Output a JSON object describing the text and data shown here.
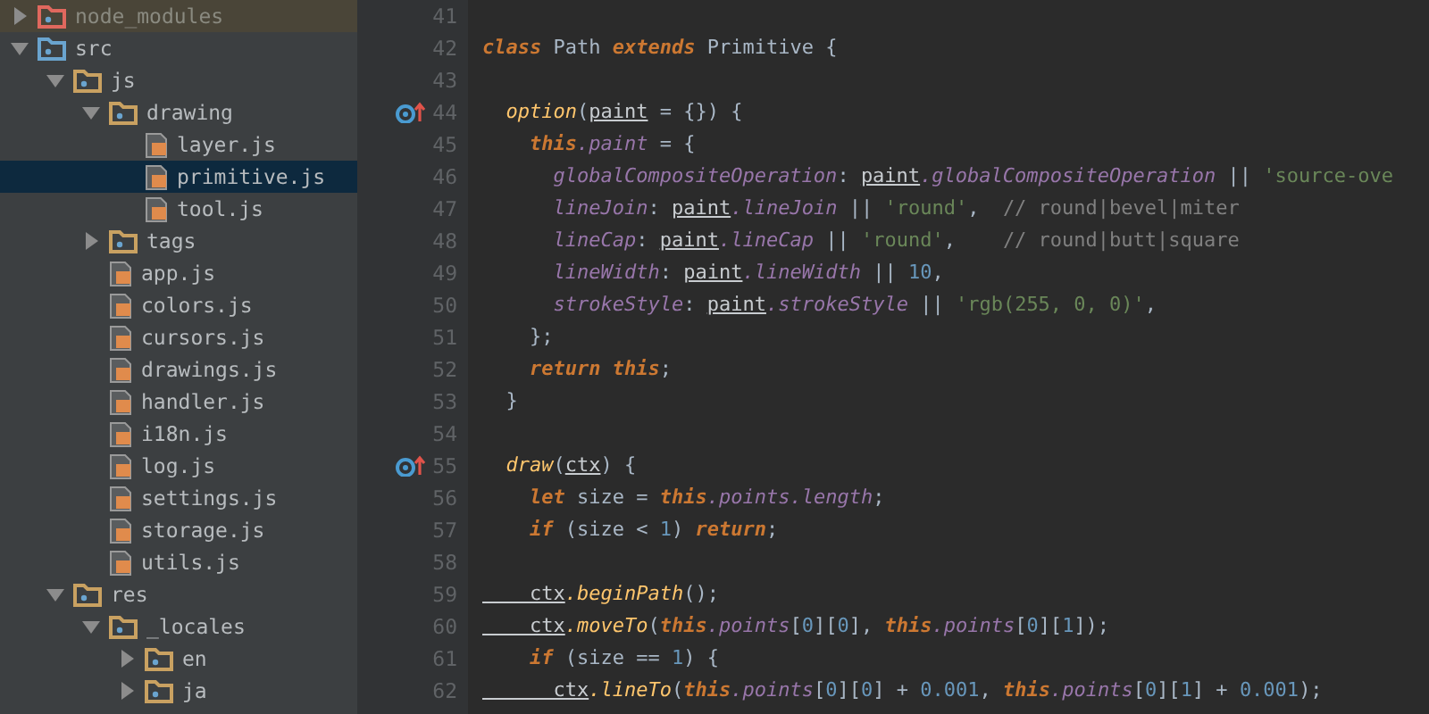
{
  "tree": [
    {
      "kind": "folder",
      "label": "node_modules",
      "color": "#e0685e",
      "expanded": false,
      "excluded": true,
      "selected": false
    },
    {
      "kind": "folder",
      "label": "src",
      "color": "#6aa4cf",
      "expanded": true,
      "excluded": false,
      "selected": false,
      "children": [
        {
          "kind": "folder",
          "label": "js",
          "color": "#c9a161",
          "expanded": true,
          "excluded": false,
          "selected": false,
          "children": [
            {
              "kind": "folder",
              "label": "drawing",
              "color": "#c9a161",
              "expanded": true,
              "excluded": false,
              "selected": false,
              "children": [
                {
                  "kind": "file",
                  "label": "layer.js",
                  "selected": false
                },
                {
                  "kind": "file",
                  "label": "primitive.js",
                  "selected": true
                },
                {
                  "kind": "file",
                  "label": "tool.js",
                  "selected": false
                }
              ]
            },
            {
              "kind": "folder",
              "label": "tags",
              "color": "#c9a161",
              "expanded": false,
              "excluded": false,
              "selected": false
            },
            {
              "kind": "file",
              "label": "app.js",
              "selected": false
            },
            {
              "kind": "file",
              "label": "colors.js",
              "selected": false
            },
            {
              "kind": "file",
              "label": "cursors.js",
              "selected": false
            },
            {
              "kind": "file",
              "label": "drawings.js",
              "selected": false
            },
            {
              "kind": "file",
              "label": "handler.js",
              "selected": false
            },
            {
              "kind": "file",
              "label": "i18n.js",
              "selected": false
            },
            {
              "kind": "file",
              "label": "log.js",
              "selected": false
            },
            {
              "kind": "file",
              "label": "settings.js",
              "selected": false
            },
            {
              "kind": "file",
              "label": "storage.js",
              "selected": false
            },
            {
              "kind": "file",
              "label": "utils.js",
              "selected": false
            }
          ]
        },
        {
          "kind": "folder",
          "label": "res",
          "color": "#c9a161",
          "expanded": true,
          "excluded": false,
          "selected": false,
          "children": [
            {
              "kind": "folder",
              "label": "_locales",
              "color": "#c9a161",
              "expanded": true,
              "excluded": false,
              "selected": false,
              "children": [
                {
                  "kind": "folder",
                  "label": "en",
                  "color": "#c9a161",
                  "expanded": false,
                  "excluded": false,
                  "selected": false
                },
                {
                  "kind": "folder",
                  "label": "ja",
                  "color": "#c9a161",
                  "expanded": false,
                  "excluded": false,
                  "selected": false
                }
              ]
            }
          ]
        }
      ]
    }
  ],
  "editor": {
    "lines": [
      {
        "number": "41",
        "marker": false
      },
      {
        "number": "42",
        "marker": false,
        "tokens": [
          {
            "kind": "kw",
            "text": "class "
          },
          {
            "kind": "name",
            "text": "Path "
          },
          {
            "kind": "kw",
            "text": "extends "
          },
          {
            "kind": "name",
            "text": "Primitive "
          },
          {
            "kind": "punct",
            "text": "{"
          }
        ]
      },
      {
        "number": "43",
        "marker": false
      },
      {
        "number": "44",
        "marker": true,
        "tokens": [
          {
            "kind": "fn",
            "text": "  option"
          },
          {
            "kind": "punct",
            "text": "("
          },
          {
            "kind": "param",
            "text": "paint"
          },
          {
            "kind": "punct",
            "text": " = {}) {"
          }
        ]
      },
      {
        "number": "45",
        "marker": false,
        "tokens": [
          {
            "kind": "kw",
            "text": "    this"
          },
          {
            "kind": "prop",
            "text": ".paint"
          },
          {
            "kind": "punct",
            "text": " = {"
          }
        ]
      },
      {
        "number": "46",
        "marker": false,
        "tokens": [
          {
            "kind": "prop",
            "text": "      globalCompositeOperation"
          },
          {
            "kind": "punct",
            "text": ": "
          },
          {
            "kind": "param",
            "text": "paint"
          },
          {
            "kind": "prop",
            "text": ".globalCompositeOperation"
          },
          {
            "kind": "punct",
            "text": " || "
          },
          {
            "kind": "str",
            "text": "'source-ove"
          }
        ]
      },
      {
        "number": "47",
        "marker": false,
        "tokens": [
          {
            "kind": "prop",
            "text": "      lineJoin"
          },
          {
            "kind": "punct",
            "text": ": "
          },
          {
            "kind": "param",
            "text": "paint"
          },
          {
            "kind": "prop",
            "text": ".lineJoin"
          },
          {
            "kind": "punct",
            "text": " || "
          },
          {
            "kind": "str",
            "text": "'round'"
          },
          {
            "kind": "punct",
            "text": ",  "
          },
          {
            "kind": "comment",
            "text": "// round|bevel|miter"
          }
        ]
      },
      {
        "number": "48",
        "marker": false,
        "tokens": [
          {
            "kind": "prop",
            "text": "      lineCap"
          },
          {
            "kind": "punct",
            "text": ": "
          },
          {
            "kind": "param",
            "text": "paint"
          },
          {
            "kind": "prop",
            "text": ".lineCap"
          },
          {
            "kind": "punct",
            "text": " || "
          },
          {
            "kind": "str",
            "text": "'round'"
          },
          {
            "kind": "punct",
            "text": ",    "
          },
          {
            "kind": "comment",
            "text": "// round|butt|square"
          }
        ]
      },
      {
        "number": "49",
        "marker": false,
        "tokens": [
          {
            "kind": "prop",
            "text": "      lineWidth"
          },
          {
            "kind": "punct",
            "text": ": "
          },
          {
            "kind": "param",
            "text": "paint"
          },
          {
            "kind": "prop",
            "text": ".lineWidth"
          },
          {
            "kind": "punct",
            "text": " || "
          },
          {
            "kind": "num",
            "text": "10"
          },
          {
            "kind": "punct",
            "text": ","
          }
        ]
      },
      {
        "number": "50",
        "marker": false,
        "tokens": [
          {
            "kind": "prop",
            "text": "      strokeStyle"
          },
          {
            "kind": "punct",
            "text": ": "
          },
          {
            "kind": "param",
            "text": "paint"
          },
          {
            "kind": "prop",
            "text": ".strokeStyle"
          },
          {
            "kind": "punct",
            "text": " || "
          },
          {
            "kind": "str",
            "text": "'rgb(255, 0, 0)'"
          },
          {
            "kind": "punct",
            "text": ","
          }
        ]
      },
      {
        "number": "51",
        "marker": false,
        "tokens": [
          {
            "kind": "punct",
            "text": "    };"
          }
        ]
      },
      {
        "number": "52",
        "marker": false,
        "tokens": [
          {
            "kind": "kw",
            "text": "    return this"
          },
          {
            "kind": "punct",
            "text": ";"
          }
        ]
      },
      {
        "number": "53",
        "marker": false,
        "tokens": [
          {
            "kind": "punct",
            "text": "  }"
          }
        ]
      },
      {
        "number": "54",
        "marker": false
      },
      {
        "number": "55",
        "marker": true,
        "tokens": [
          {
            "kind": "fn",
            "text": "  draw"
          },
          {
            "kind": "punct",
            "text": "("
          },
          {
            "kind": "param",
            "text": "ctx"
          },
          {
            "kind": "punct",
            "text": ") {"
          }
        ]
      },
      {
        "number": "56",
        "marker": false,
        "tokens": [
          {
            "kind": "kw",
            "text": "    let "
          },
          {
            "kind": "name",
            "text": "size"
          },
          {
            "kind": "punct",
            "text": " = "
          },
          {
            "kind": "kw",
            "text": "this"
          },
          {
            "kind": "prop",
            "text": ".points.length"
          },
          {
            "kind": "punct",
            "text": ";"
          }
        ]
      },
      {
        "number": "57",
        "marker": false,
        "tokens": [
          {
            "kind": "kw",
            "text": "    if "
          },
          {
            "kind": "punct",
            "text": "("
          },
          {
            "kind": "name",
            "text": "size"
          },
          {
            "kind": "punct",
            "text": " < "
          },
          {
            "kind": "num",
            "text": "1"
          },
          {
            "kind": "punct",
            "text": ") "
          },
          {
            "kind": "kw",
            "text": "return"
          },
          {
            "kind": "punct",
            "text": ";"
          }
        ]
      },
      {
        "number": "58",
        "marker": false
      },
      {
        "number": "59",
        "marker": false,
        "tokens": [
          {
            "kind": "param",
            "text": "    ctx"
          },
          {
            "kind": "fn",
            "text": ".beginPath"
          },
          {
            "kind": "punct",
            "text": "();"
          }
        ]
      },
      {
        "number": "60",
        "marker": false,
        "tokens": [
          {
            "kind": "param",
            "text": "    ctx"
          },
          {
            "kind": "fn",
            "text": ".moveTo"
          },
          {
            "kind": "punct",
            "text": "("
          },
          {
            "kind": "kw",
            "text": "this"
          },
          {
            "kind": "prop",
            "text": ".points"
          },
          {
            "kind": "punct",
            "text": "["
          },
          {
            "kind": "num",
            "text": "0"
          },
          {
            "kind": "punct",
            "text": "]["
          },
          {
            "kind": "num",
            "text": "0"
          },
          {
            "kind": "punct",
            "text": "], "
          },
          {
            "kind": "kw",
            "text": "this"
          },
          {
            "kind": "prop",
            "text": ".points"
          },
          {
            "kind": "punct",
            "text": "["
          },
          {
            "kind": "num",
            "text": "0"
          },
          {
            "kind": "punct",
            "text": "]["
          },
          {
            "kind": "num",
            "text": "1"
          },
          {
            "kind": "punct",
            "text": "]);"
          }
        ]
      },
      {
        "number": "61",
        "marker": false,
        "tokens": [
          {
            "kind": "kw",
            "text": "    if "
          },
          {
            "kind": "punct",
            "text": "("
          },
          {
            "kind": "name",
            "text": "size"
          },
          {
            "kind": "punct",
            "text": " == "
          },
          {
            "kind": "num",
            "text": "1"
          },
          {
            "kind": "punct",
            "text": ") {"
          }
        ]
      },
      {
        "number": "62",
        "marker": false,
        "tokens": [
          {
            "kind": "param",
            "text": "      ctx"
          },
          {
            "kind": "fn",
            "text": ".lineTo"
          },
          {
            "kind": "punct",
            "text": "("
          },
          {
            "kind": "kw",
            "text": "this"
          },
          {
            "kind": "prop",
            "text": ".points"
          },
          {
            "kind": "punct",
            "text": "["
          },
          {
            "kind": "num",
            "text": "0"
          },
          {
            "kind": "punct",
            "text": "]["
          },
          {
            "kind": "num",
            "text": "0"
          },
          {
            "kind": "punct",
            "text": "] + "
          },
          {
            "kind": "num",
            "text": "0.001"
          },
          {
            "kind": "punct",
            "text": ", "
          },
          {
            "kind": "kw",
            "text": "this"
          },
          {
            "kind": "prop",
            "text": ".points"
          },
          {
            "kind": "punct",
            "text": "["
          },
          {
            "kind": "num",
            "text": "0"
          },
          {
            "kind": "punct",
            "text": "]["
          },
          {
            "kind": "num",
            "text": "1"
          },
          {
            "kind": "punct",
            "text": "] + "
          },
          {
            "kind": "num",
            "text": "0.001"
          },
          {
            "kind": "punct",
            "text": ");"
          }
        ]
      }
    ]
  }
}
